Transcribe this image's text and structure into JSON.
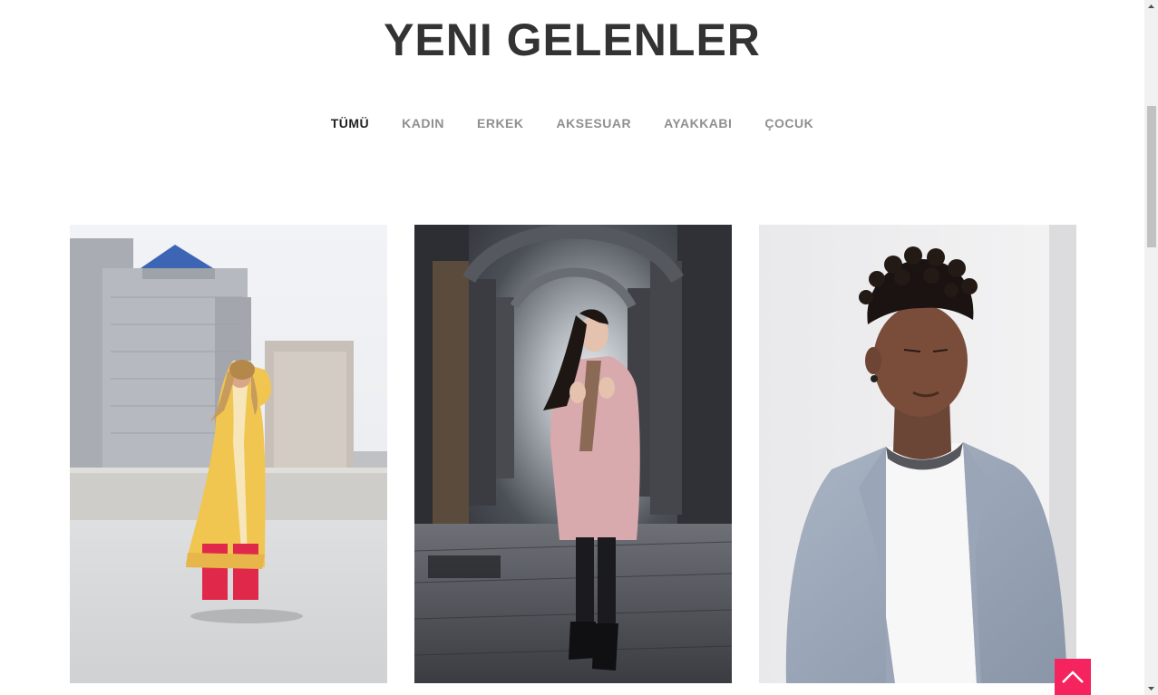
{
  "section": {
    "title": "YENI GELENLER"
  },
  "filters": [
    {
      "label": "TÜMÜ",
      "active": true
    },
    {
      "label": "KADIN",
      "active": false
    },
    {
      "label": "ERKEK",
      "active": false
    },
    {
      "label": "AKSESUAR",
      "active": false
    },
    {
      "label": "AYAKKABI",
      "active": false
    },
    {
      "label": "ÇOCUK",
      "active": false
    }
  ],
  "products": [
    {
      "image": "woman-yellow-dress-rooftop-photo"
    },
    {
      "image": "woman-pink-coat-archway-photo"
    },
    {
      "image": "man-grey-blazer-portrait-photo"
    }
  ],
  "colors": {
    "title": "#333333",
    "filter_active": "#222222",
    "filter_inactive": "#8f8f8f",
    "back_to_top_bg": "#f5245e"
  },
  "icons": {
    "back_to_top": "chevron-up-icon"
  }
}
